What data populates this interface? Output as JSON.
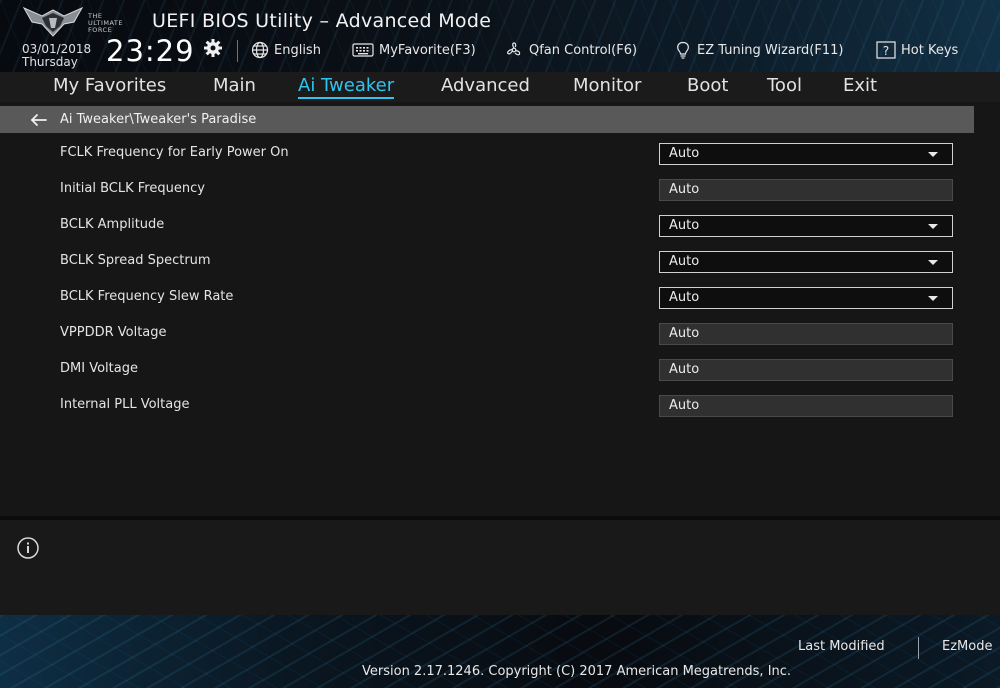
{
  "header": {
    "logo_text": "THE ULTIMATE FORCE",
    "title": "UEFI BIOS Utility – Advanced Mode",
    "date": "03/01/2018",
    "weekday": "Thursday",
    "time": "23:29",
    "buttons": [
      {
        "label": "English",
        "icon": "globe-icon"
      },
      {
        "label": "MyFavorite(F3)",
        "icon": "keyboard-icon"
      },
      {
        "label": "Qfan Control(F6)",
        "icon": "fan-icon"
      },
      {
        "label": "EZ Tuning Wizard(F11)",
        "icon": "lightbulb-icon"
      },
      {
        "label": "Hot Keys",
        "icon": "help-icon"
      }
    ]
  },
  "nav": {
    "tabs": [
      {
        "label": "My Favorites"
      },
      {
        "label": "Main"
      },
      {
        "label": "Ai Tweaker"
      },
      {
        "label": "Advanced"
      },
      {
        "label": "Monitor"
      },
      {
        "label": "Boot"
      },
      {
        "label": "Tool"
      },
      {
        "label": "Exit"
      }
    ],
    "active": "Ai Tweaker"
  },
  "breadcrumb": "Ai Tweaker\\Tweaker's Paradise",
  "settings": [
    {
      "label": "FCLK Frequency for Early Power On",
      "value": "Auto",
      "control": "dropdown"
    },
    {
      "label": "Initial BCLK Frequency",
      "value": "Auto",
      "control": "field"
    },
    {
      "label": "BCLK Amplitude",
      "value": "Auto",
      "control": "dropdown"
    },
    {
      "label": "BCLK Spread Spectrum",
      "value": "Auto",
      "control": "dropdown"
    },
    {
      "label": "BCLK Frequency Slew Rate",
      "value": "Auto",
      "control": "dropdown"
    },
    {
      "label": "VPPDDR Voltage",
      "value": "Auto",
      "control": "field"
    },
    {
      "label": "DMI Voltage",
      "value": "Auto",
      "control": "field"
    },
    {
      "label": "Internal PLL Voltage",
      "value": "Auto",
      "control": "field"
    }
  ],
  "footer": {
    "last_modified": "Last Modified",
    "ez_mode": "EzMode",
    "version": "Version 2.17.1246. Copyright (C) 2017 American Megatrends, Inc."
  },
  "colors": {
    "accent": "#2fc4ee",
    "breadcrumb_bg": "#595959",
    "field_bg": "#303030"
  }
}
